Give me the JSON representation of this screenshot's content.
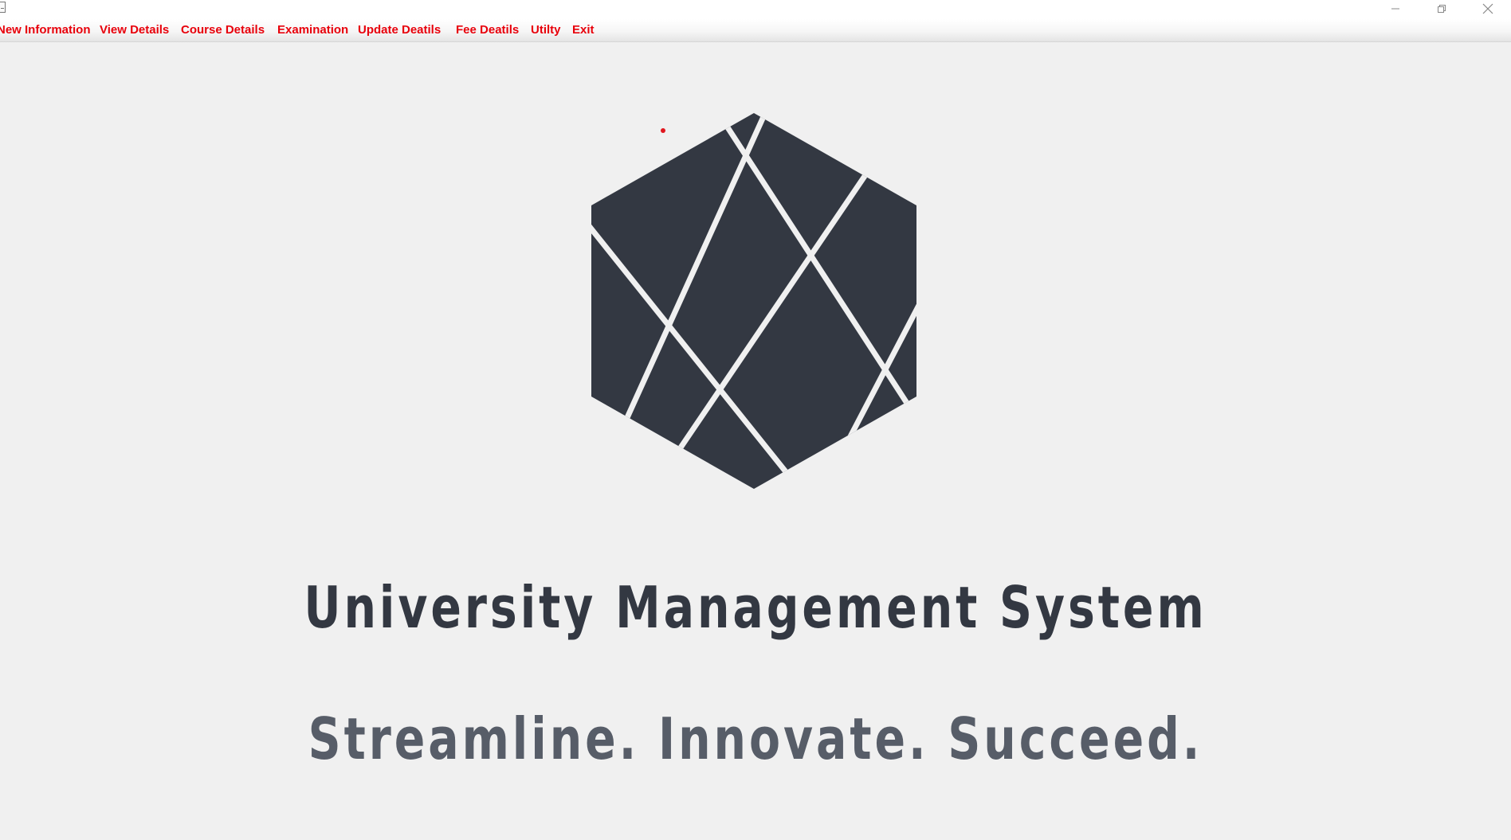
{
  "window": {
    "controls": {
      "minimize_icon": "minimize-icon",
      "restore_icon": "restore-icon",
      "close_icon": "close-icon"
    }
  },
  "menu": {
    "items": [
      {
        "label": "New Information"
      },
      {
        "label": "View Details"
      },
      {
        "label": "Course Details"
      },
      {
        "label": "Examination"
      },
      {
        "label": "Update Deatils"
      },
      {
        "label": "Fee Deatils"
      },
      {
        "label": "Utilty"
      },
      {
        "label": "Exit"
      }
    ]
  },
  "hero": {
    "title": "University Management System",
    "tagline": "Streamline. Innovate. Succeed."
  },
  "colors": {
    "menu_text": "#e8000b",
    "logo_fill": "#333842",
    "title_text": "#333842",
    "tagline_text": "#575d68",
    "background": "#f0f0f0"
  }
}
